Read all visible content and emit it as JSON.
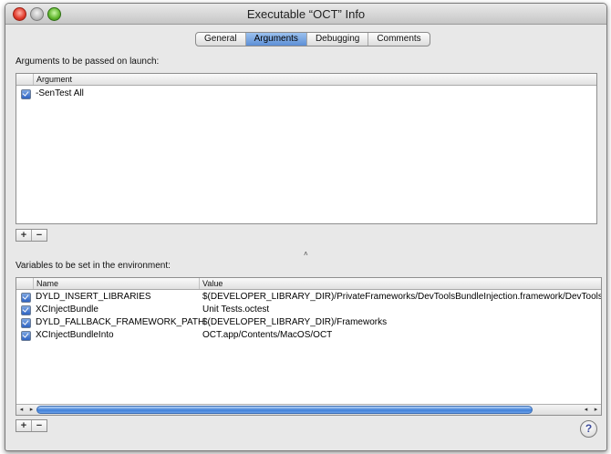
{
  "window": {
    "title": "Executable “OCT” Info"
  },
  "tabs": [
    {
      "label": "General",
      "active": false
    },
    {
      "label": "Arguments",
      "active": true
    },
    {
      "label": "Debugging",
      "active": false
    },
    {
      "label": "Comments",
      "active": false
    }
  ],
  "arguments": {
    "section_label": "Arguments to be passed on launch:",
    "column_header": "Argument",
    "rows": [
      {
        "checked": true,
        "value": "-SenTest All"
      }
    ],
    "add_label": "+",
    "remove_label": "−"
  },
  "environment": {
    "section_label": "Variables to be set in the environment:",
    "columns": {
      "name": "Name",
      "value": "Value"
    },
    "rows": [
      {
        "checked": true,
        "name": "DYLD_INSERT_LIBRARIES",
        "value": "$(DEVELOPER_LIBRARY_DIR)/PrivateFrameworks/DevToolsBundleInjection.framework/DevToolsBund"
      },
      {
        "checked": true,
        "name": "XCInjectBundle",
        "value": "Unit Tests.octest"
      },
      {
        "checked": true,
        "name": "DYLD_FALLBACK_FRAMEWORK_PATH",
        "value": "$(DEVELOPER_LIBRARY_DIR)/Frameworks"
      },
      {
        "checked": true,
        "name": "XCInjectBundleInto",
        "value": "OCT.app/Contents/MacOS/OCT"
      }
    ],
    "add_label": "+",
    "remove_label": "−",
    "scrollbar": {
      "left_arrow": "◂",
      "right_arrow": "▸"
    }
  },
  "splitter": {
    "glyph": "˄"
  },
  "help": {
    "label": "?"
  },
  "colors": {
    "accent": "#3f7fd8",
    "window_bg": "#e8e8e8"
  }
}
